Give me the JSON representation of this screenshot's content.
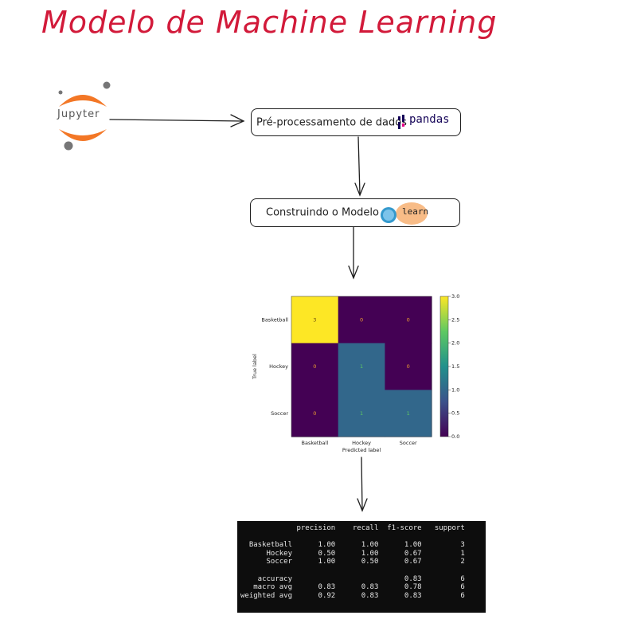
{
  "title": "Modelo de Machine Learning",
  "jupyter": {
    "label": "Jupyter"
  },
  "step1": {
    "label": "Pré-processamento de dados",
    "logo_text": "pandas"
  },
  "step2": {
    "label": "Construindo o Modelo",
    "logo_text": "learn"
  },
  "colors": {
    "title": "#d21a3a",
    "jupyter_orange": "#f37726",
    "jupyter_gray": "#767677"
  },
  "chart_data": {
    "type": "heatmap",
    "title": "",
    "xlabel": "Predicted label",
    "ylabel": "True label",
    "x_categories": [
      "Basketball",
      "Hockey",
      "Soccer"
    ],
    "y_categories": [
      "Basketball",
      "Hockey",
      "Soccer"
    ],
    "values": [
      [
        3,
        0,
        0
      ],
      [
        0,
        1,
        0
      ],
      [
        0,
        1,
        1
      ]
    ],
    "colorbar": {
      "range": [
        0.0,
        3.0
      ],
      "ticks": [
        "0.0",
        "0.5",
        "1.0",
        "1.5",
        "2.0",
        "2.5",
        "3.0"
      ]
    },
    "colormap": "viridis"
  },
  "report": {
    "header": [
      "precision",
      "recall",
      "f1-score",
      "support"
    ],
    "rows": [
      {
        "label": "Basketball",
        "values": [
          "1.00",
          "1.00",
          "1.00",
          "3"
        ]
      },
      {
        "label": "Hockey",
        "values": [
          "0.50",
          "1.00",
          "0.67",
          "1"
        ]
      },
      {
        "label": "Soccer",
        "values": [
          "1.00",
          "0.50",
          "0.67",
          "2"
        ]
      }
    ],
    "summary": [
      {
        "label": "accuracy",
        "values": [
          "",
          "",
          "0.83",
          "6"
        ]
      },
      {
        "label": "macro avg",
        "values": [
          "0.83",
          "0.83",
          "0.78",
          "6"
        ]
      },
      {
        "label": "weighted avg",
        "values": [
          "0.92",
          "0.83",
          "0.83",
          "6"
        ]
      }
    ]
  }
}
